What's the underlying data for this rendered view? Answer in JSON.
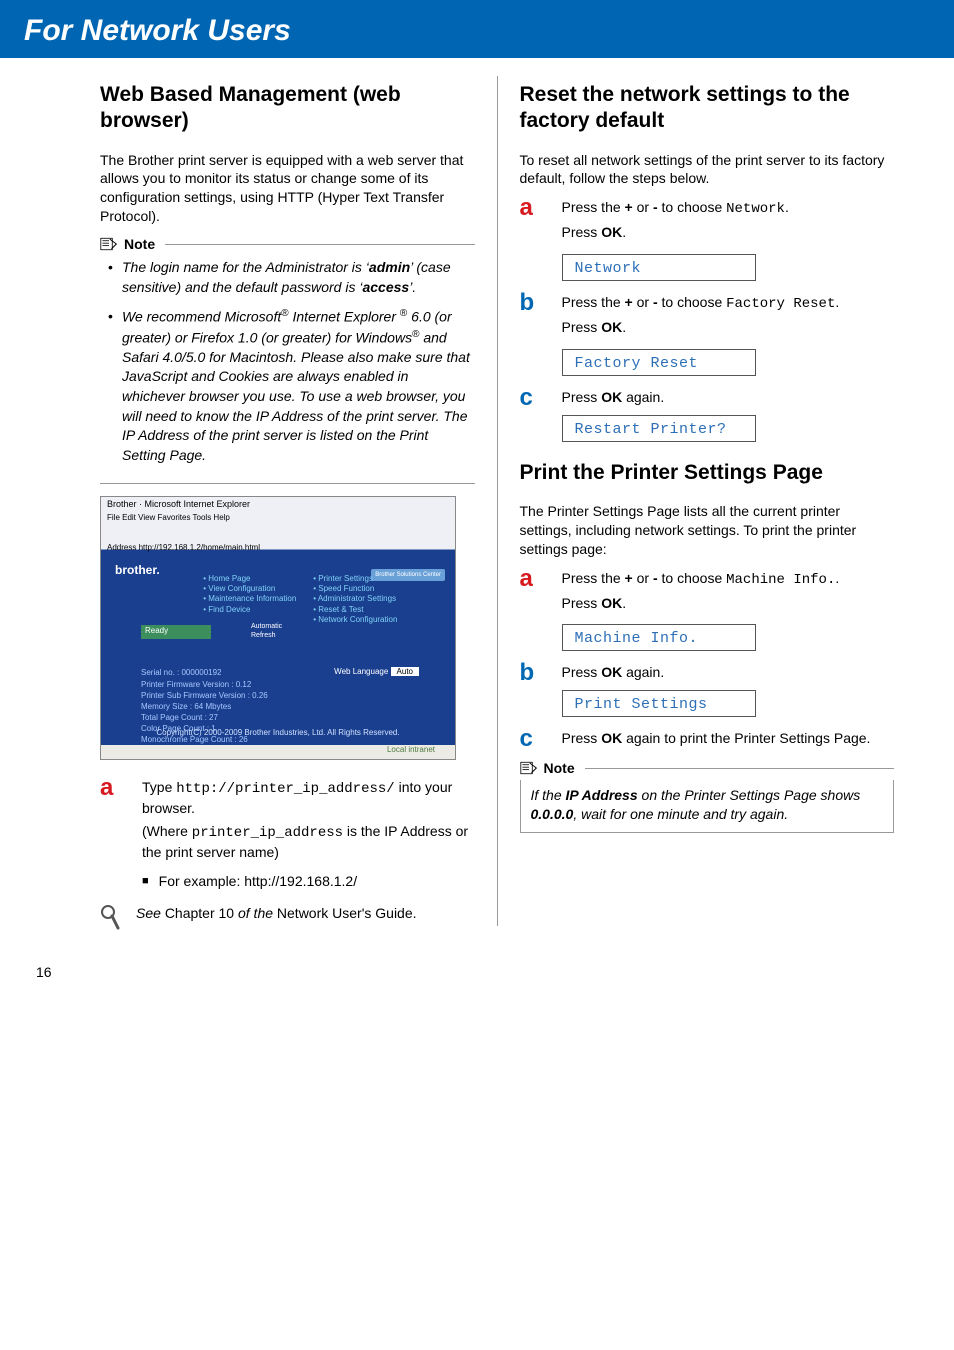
{
  "header": {
    "title": "For Network Users"
  },
  "page_number": "16",
  "left": {
    "heading": "Web Based Management (web browser)",
    "intro": "The Brother print server is equipped with a web server that allows you to monitor its status or change some of its configuration settings, using HTTP (Hyper Text Transfer Protocol).",
    "note_label": "Note",
    "note_items": {
      "item1_pre": "The login name for the Administrator is ‘",
      "item1_admin": "admin",
      "item1_mid": "’ (case sensitive) and the default password is ‘",
      "item1_access": "access",
      "item1_post": "’.",
      "item2_pre": "We recommend Microsoft",
      "item2_ie": " Internet Explorer ",
      "item2_mid1": "6.0 (or greater) or Firefox 1.0 (or greater) for Windows",
      "item2_mid2": " and Safari 4.0/5.0 for Macintosh. Please also make sure that JavaScript and Cookies are always enabled in whichever browser you use. To use a web browser, you will need to know the IP Address of the print server. The IP Address of the print server is listed on the Print Setting Page."
    },
    "screenshot": {
      "title": "Brother · Microsoft Internet Explorer",
      "menu": "File  Edit  View  Favorites  Tools  Help",
      "addr": "Address  http://192.168.1.2/home/main.html",
      "brother": "brother.",
      "links_col1": "• Home Page\n• View Configuration\n• Maintenance Information\n• Find Device",
      "links_col2": "• Printer Settings\n• Speed Function\n• Administrator Settings\n• Reset & Test\n• Network Configuration",
      "sol": "Brother Solutions Center",
      "ready": "Ready",
      "auto_refresh": "Automatic\nRefresh",
      "lang_label": "Web Language",
      "lang_val": "Auto",
      "info": "Serial no. : 000000192\nPrinter Firmware Version : 0.12\nPrinter Sub Firmware Version : 0.26\nMemory Size : 64 Mbytes\nTotal Page Count : 27\nColor Page Count : 1\nMonochrome Page Count : 26",
      "copyright": "Copyright(C) 2000-2009 Brother Industries, Ltd. All Rights Reserved.",
      "footer": "Local intranet"
    },
    "step_a": {
      "letter": "a",
      "line1_pre": "Type ",
      "line1_code": "http://printer_ip_address/",
      "line1_post": " into your browser.",
      "line2_pre": " (Where ",
      "line2_code": "printer_ip_address",
      "line2_post": " is the IP Address or the print server name)",
      "bullet": "For example: http://192.168.1.2/"
    },
    "see": {
      "pre_i": "See ",
      "mid": "Chapter 10 ",
      "mid_i": "of the ",
      "post": "Network User's Guide",
      "dot": "."
    }
  },
  "right": {
    "heading1": "Reset the network settings to the factory default",
    "intro1": "To reset all network settings of the print server to its factory default, follow the steps below.",
    "r1_steps": {
      "a_letter": "a",
      "a_pre": "Press the ",
      "a_plus": "+",
      "a_or": " or ",
      "a_minus": "-",
      "a_mid": " to choose ",
      "a_code": "Network",
      "a_post": ".",
      "a_line2_pre": "Press ",
      "a_line2_ok": "OK",
      "a_line2_post": ".",
      "a_lcd": "Network",
      "b_letter": "b",
      "b_pre": "Press the ",
      "b_plus": "+",
      "b_or": " or ",
      "b_minus": "-",
      "b_mid": " to choose ",
      "b_code": "Factory Reset",
      "b_post": ".",
      "b_line2_pre": "Press ",
      "b_line2_ok": "OK",
      "b_line2_post": ".",
      "b_lcd": "Factory Reset",
      "c_letter": "c",
      "c_pre": "Press ",
      "c_ok": "OK",
      "c_post": " again.",
      "c_lcd": "Restart Printer?"
    },
    "heading2": "Print the Printer Settings Page",
    "intro2": "The Printer Settings Page lists all the current printer settings, including network settings. To print the printer settings page:",
    "r2_steps": {
      "a_letter": "a",
      "a_pre": "Press the ",
      "a_plus": "+",
      "a_or": " or ",
      "a_minus": "-",
      "a_mid": " to choose ",
      "a_code": "Machine Info.",
      "a_post": ".",
      "a_line2_pre": "Press ",
      "a_line2_ok": "OK",
      "a_line2_post": ".",
      "a_lcd": "Machine Info.",
      "b_letter": "b",
      "b_pre": "Press ",
      "b_ok": "OK",
      "b_post": " again.",
      "b_lcd": "Print Settings",
      "c_letter": "c",
      "c_pre": "Press ",
      "c_ok": "OK",
      "c_post": " again to print the Printer Settings Page."
    },
    "note_label": "Note",
    "note2_pre": "If the ",
    "note2_ip": "IP Address",
    "note2_mid": " on the Printer Settings Page shows ",
    "note2_zero": "0.0.0.0",
    "note2_post": ", wait for one minute and try again."
  }
}
